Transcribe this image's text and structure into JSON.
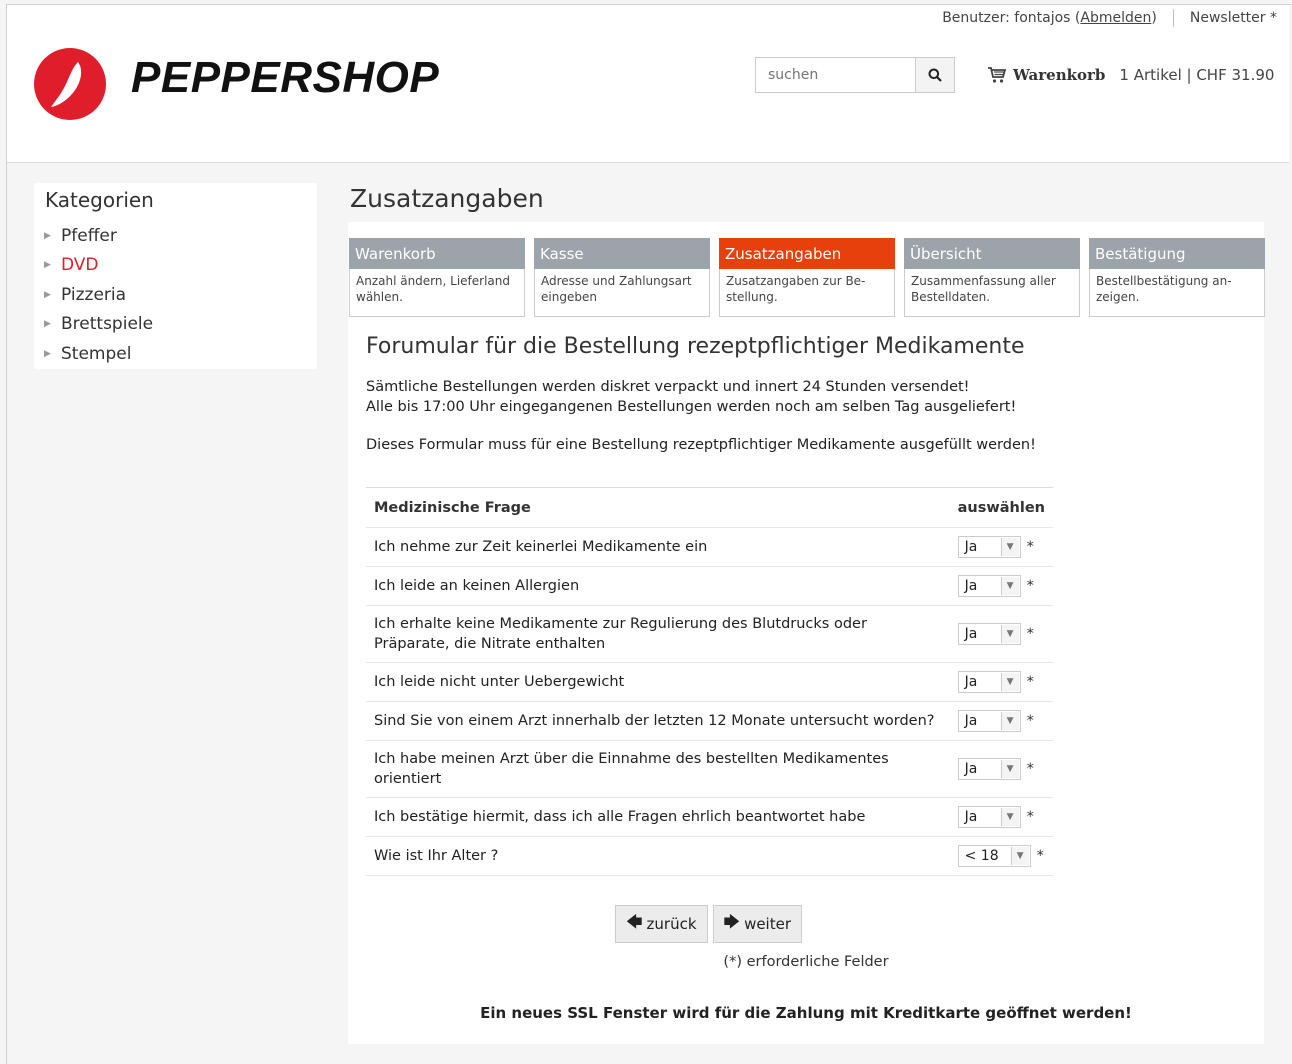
{
  "header": {
    "user_label": "Benutzer: fontajos (",
    "logout_link": "Abmelden",
    "user_close": ")",
    "newsletter": "Newsletter *",
    "logo_text": "PEPPERSHOP",
    "search_placeholder": "suchen",
    "cart_label": "Warenkorb",
    "cart_info": "1 Artikel | CHF 31.90"
  },
  "sidebar": {
    "title": "Kategorien",
    "items": [
      {
        "label": "Pfeffer"
      },
      {
        "label": "DVD"
      },
      {
        "label": "Pizzeria"
      },
      {
        "label": "Brettspiele"
      },
      {
        "label": "Stempel"
      }
    ]
  },
  "main": {
    "page_title": "Zusatzangaben",
    "steps": [
      {
        "title": "Warenkorb",
        "desc": "Anzahl ändern, Lieferland wählen."
      },
      {
        "title": "Kasse",
        "desc": "Adresse und Zahlungsart eingeben"
      },
      {
        "title": "Zusatzangaben",
        "desc": "Zusatzangaben zur Be-stellung."
      },
      {
        "title": "Übersicht",
        "desc": "Zusammenfassung aller Bestelldaten."
      },
      {
        "title": "Bestätigung",
        "desc": "Bestellbestätigung an-zeigen."
      }
    ],
    "form_title": "Forumular für die Bestellung rezeptpflichtiger Medikamente",
    "intro_line1": "Sämtliche Bestellungen werden diskret verpackt und innert 24 Stunden versendet!",
    "intro_line2": "Alle bis 17:00 Uhr eingegangenen Bestellungen werden noch am selben Tag ausgeliefert!",
    "intro_line3": "Dieses Formular muss für eine Bestellung rezeptpflichtiger Medikamente ausgefüllt werden!",
    "table": {
      "col_question": "Medizinische Frage",
      "col_select": "auswählen",
      "rows": [
        {
          "question": "Ich nehme zur Zeit keinerlei Medikamente ein",
          "value": "Ja"
        },
        {
          "question": "Ich leide an keinen Allergien",
          "value": "Ja"
        },
        {
          "question": "Ich erhalte keine Medikamente zur Regulierung des Blutdrucks oder Präparate, die Nitrate enthalten",
          "value": "Ja"
        },
        {
          "question": "Ich leide nicht unter Uebergewicht",
          "value": "Ja"
        },
        {
          "question": "Sind Sie von einem Arzt innerhalb der letzten 12 Monate untersucht worden?",
          "value": "Ja"
        },
        {
          "question": "Ich habe meinen Arzt über die Einnahme des bestellten Medikamentes orientiert",
          "value": "Ja"
        },
        {
          "question": "Ich bestätige hiermit, dass ich alle Fragen ehrlich beantwortet habe",
          "value": "Ja"
        },
        {
          "question": "Wie ist Ihr Alter ?",
          "value": "< 18"
        }
      ]
    },
    "required_star": "*",
    "back_button": "zurück",
    "next_button": "weiter",
    "required_note": "(*) erforderliche Felder",
    "ssl_note": "Ein neues SSL Fenster wird für die Zahlung mit Kreditkarte geöffnet werden!"
  }
}
